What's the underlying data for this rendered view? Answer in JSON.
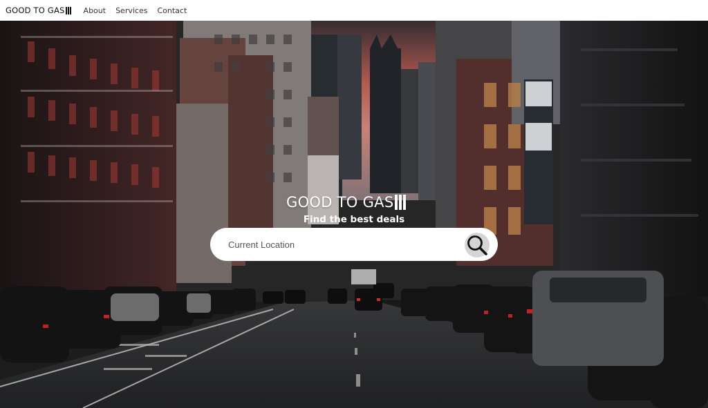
{
  "navbar": {
    "brand": "GOOD TO GAS",
    "links": [
      "About",
      "Services",
      "Contact"
    ]
  },
  "hero": {
    "title": "GOOD TO GAS",
    "subtitle": "Find the best deals",
    "background_icon": "city-street-photo"
  },
  "search": {
    "placeholder": "Current Location",
    "value": "",
    "button_icon": "search-icon"
  },
  "colors": {
    "navbar_bg": "#ffffff",
    "text_dark": "#111111",
    "hero_text": "#ffffff",
    "search_bg": "#ffffff",
    "search_button_bg": "#d5d5d5"
  }
}
